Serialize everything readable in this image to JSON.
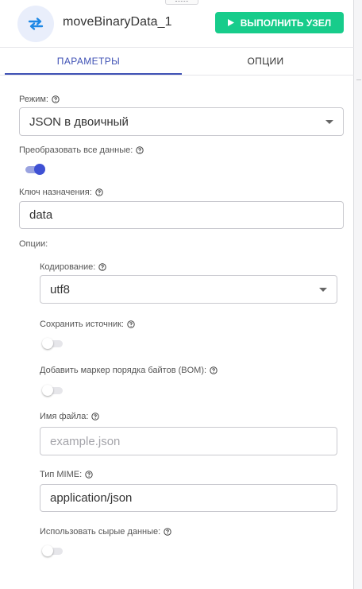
{
  "header": {
    "node_title": "moveBinaryData_1",
    "run_button_label": "ВЫПОЛНИТЬ УЗЕЛ",
    "node_icon": "swap-arrows-icon",
    "run_icon": "play-icon"
  },
  "tabs": [
    {
      "label": "ПАРАМЕТРЫ",
      "active": true
    },
    {
      "label": "ОПЦИИ",
      "active": false
    }
  ],
  "form": {
    "mode": {
      "label": "Режим:",
      "value": "JSON в двоичный"
    },
    "convert_all": {
      "label": "Преобразовать все данные:",
      "on": true
    },
    "destination_key": {
      "label": "Ключ назначения:",
      "value": "data"
    },
    "options_label": "Опции:",
    "encoding": {
      "label": "Кодирование:",
      "value": "utf8"
    },
    "keep_source": {
      "label": "Сохранить источник:",
      "on": false
    },
    "add_bom": {
      "label": "Добавить маркер порядка байтов (BOM):",
      "on": false
    },
    "file_name": {
      "label": "Имя файла:",
      "value": "",
      "placeholder": "example.json"
    },
    "mime_type": {
      "label": "Тип MIME:",
      "value": "application/json"
    },
    "use_raw_data": {
      "label": "Использовать сырые данные:",
      "on": false
    }
  },
  "colors": {
    "accent": "#3f51b5",
    "run_button": "#17cc8b",
    "toggle_on": "#3f51d4"
  }
}
